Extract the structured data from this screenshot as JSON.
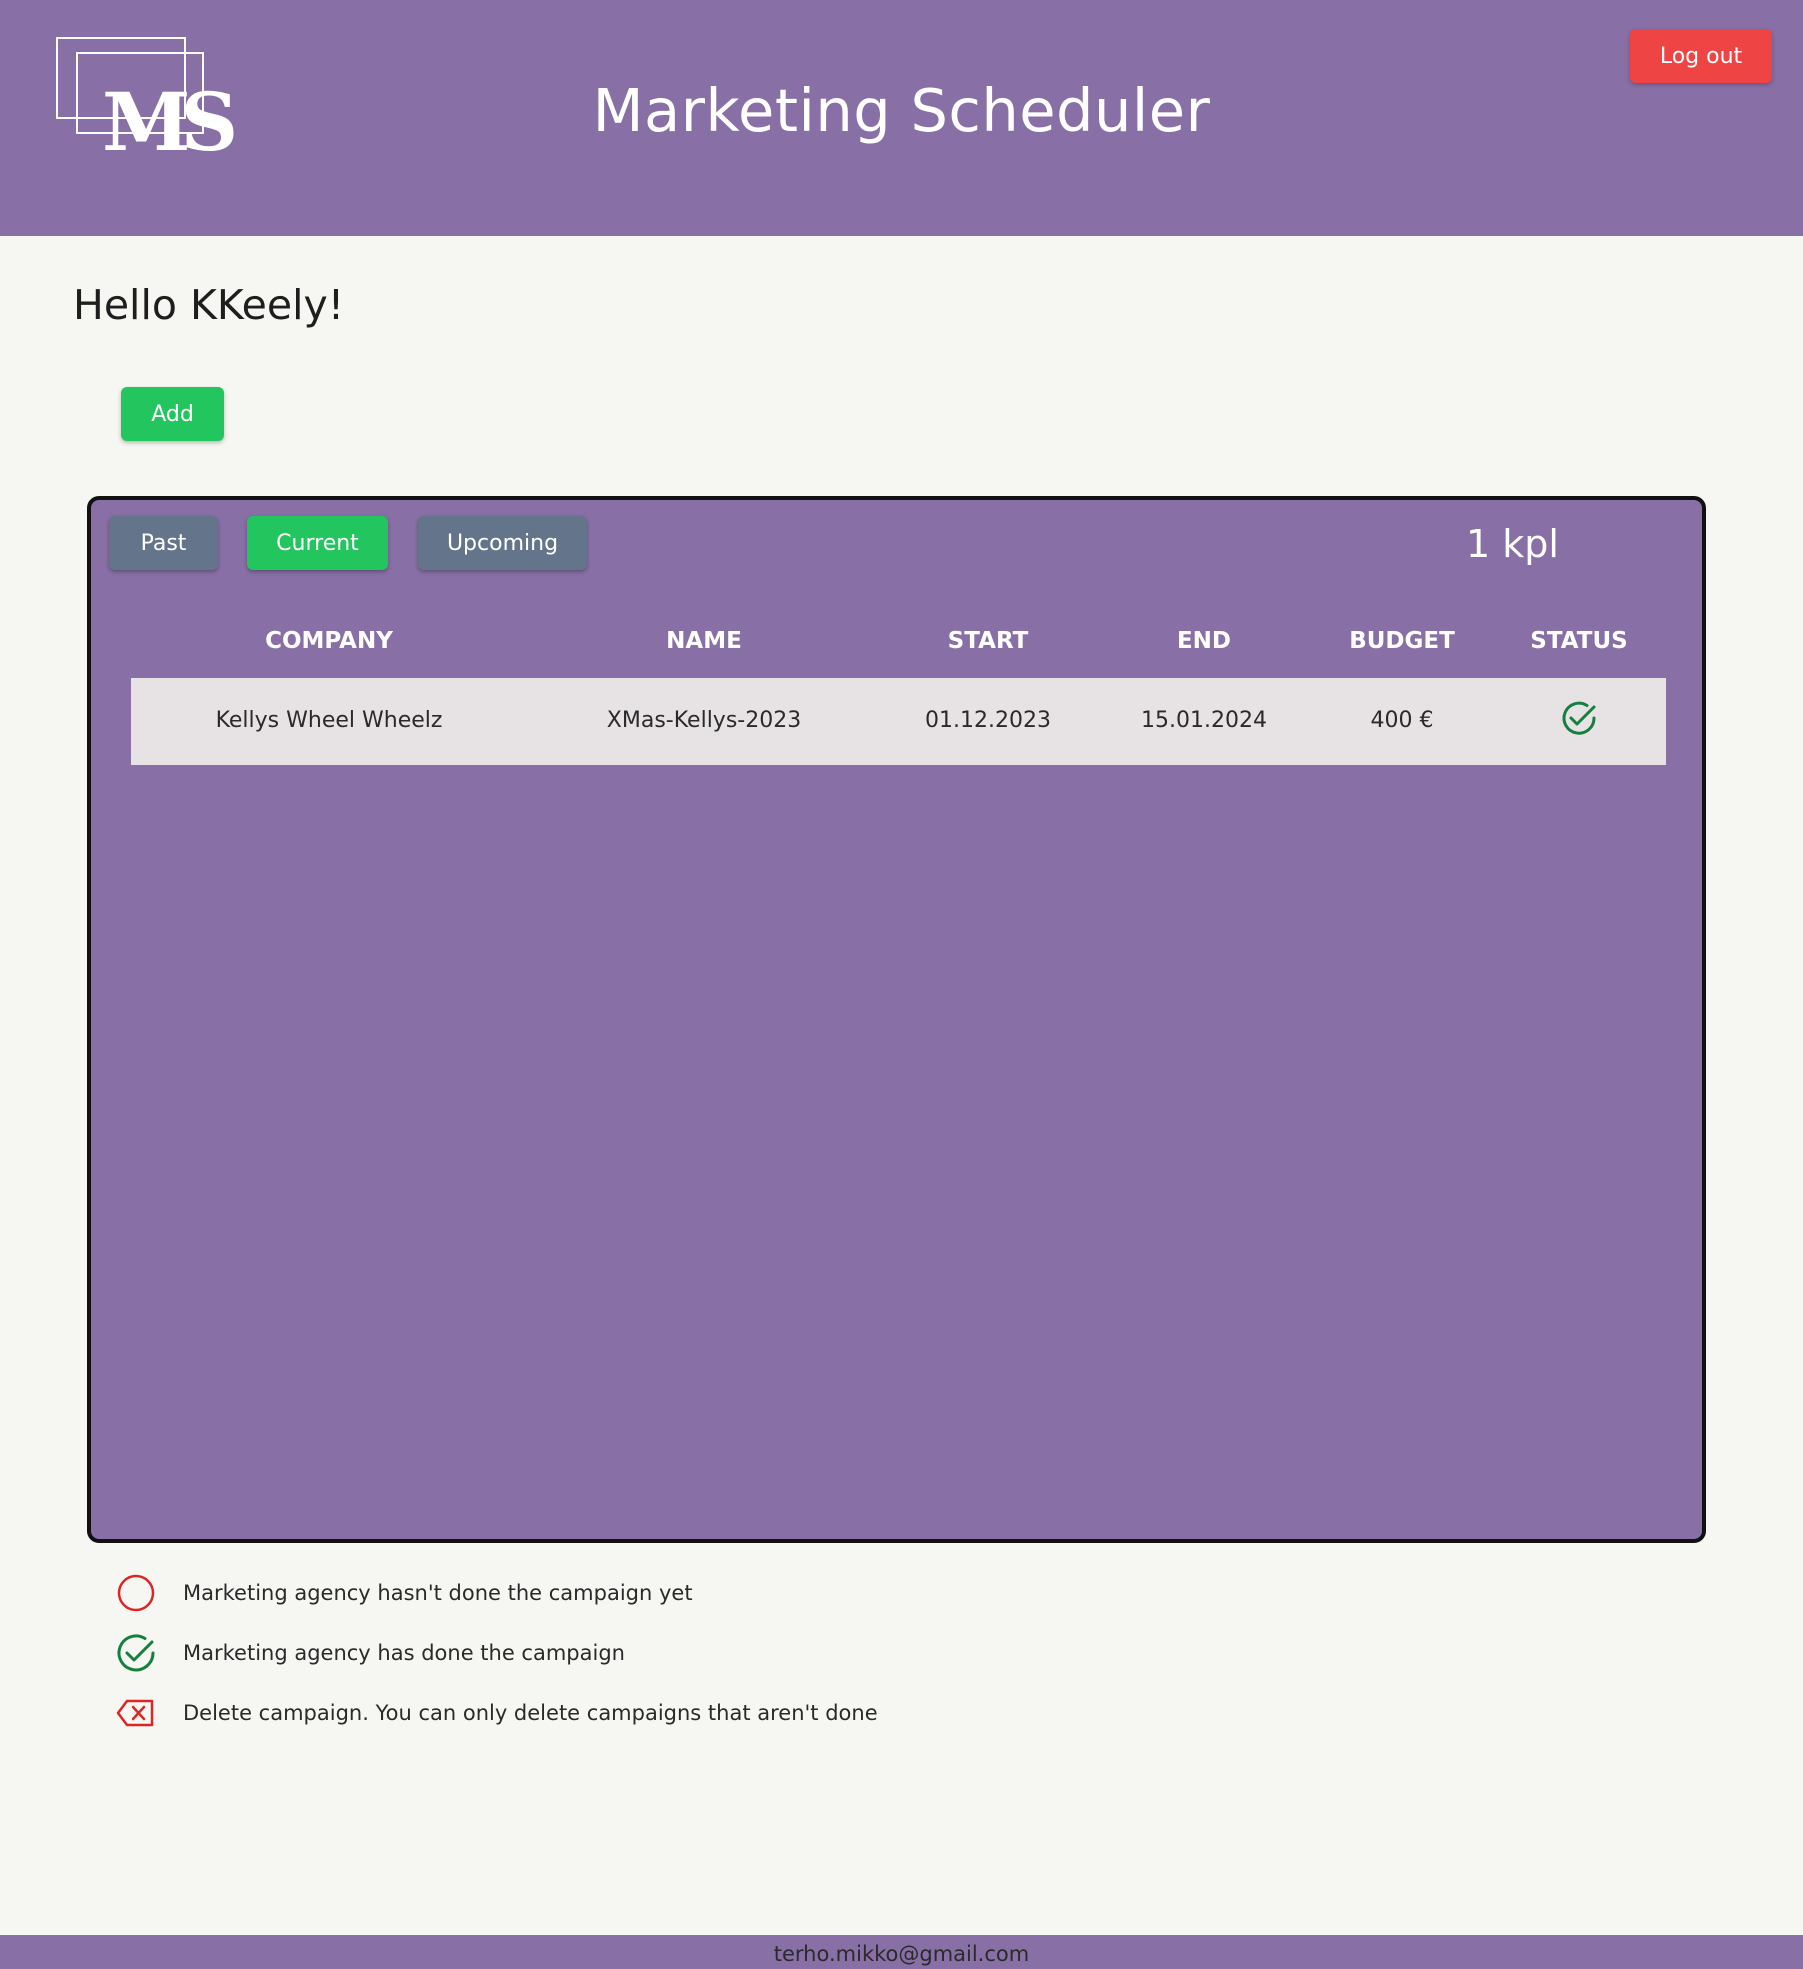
{
  "header": {
    "logo_text": "MS",
    "title": "Marketing Scheduler",
    "logout_label": "Log out"
  },
  "greeting": "Hello KKeely!",
  "add_label": "Add",
  "tabs": [
    {
      "label": "Past",
      "active": false
    },
    {
      "label": "Current",
      "active": true
    },
    {
      "label": "Upcoming",
      "active": false
    }
  ],
  "count_label": "1 kpl",
  "table": {
    "columns": [
      "COMPANY",
      "NAME",
      "START",
      "END",
      "BUDGET",
      "STATUS"
    ],
    "rows": [
      {
        "company": "Kellys Wheel Wheelz",
        "name": "XMas-Kellys-2023",
        "start": "01.12.2023",
        "end": "15.01.2024",
        "budget": "400 €",
        "status": "done"
      }
    ]
  },
  "legend": [
    {
      "icon": "circle-icon",
      "text": "Marketing agency hasn't done the campaign yet"
    },
    {
      "icon": "check-circle-icon",
      "text": "Marketing agency has done the campaign"
    },
    {
      "icon": "delete-icon",
      "text": "Delete campaign. You can only delete campaigns that aren't done"
    }
  ],
  "footer": {
    "email": "terho.mikko@gmail.com"
  },
  "colors": {
    "brand_purple": "#8870a6",
    "danger_red": "#ef4444",
    "success_green": "#22c55e",
    "tab_gray": "#64748b",
    "row_bg": "#e7e3e4",
    "page_bg": "#f6f7f2"
  }
}
